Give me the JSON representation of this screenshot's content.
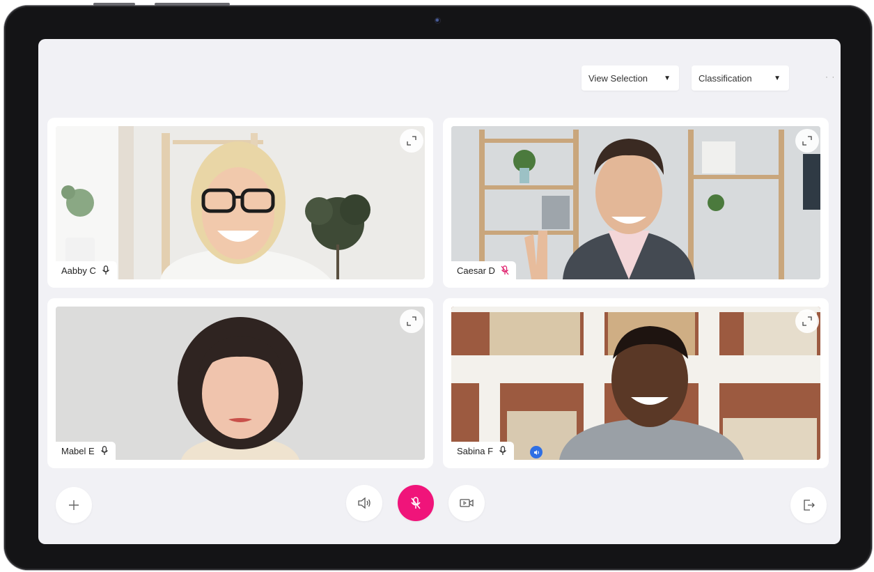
{
  "toolbar": {
    "view_selection": "View Selection",
    "classification": "Classification"
  },
  "participants": [
    {
      "name": "Aabby C",
      "mic": "on"
    },
    {
      "name": "Caesar D",
      "mic": "muted"
    },
    {
      "name": "Mabel E",
      "mic": "on"
    },
    {
      "name": "Sabina F",
      "mic": "on",
      "speaking": true
    }
  ],
  "colors": {
    "accent": "#f0147a",
    "muted_icon": "#e0246f",
    "speaking_badge": "#2f6fe4",
    "screen_bg": "#f1f1f5"
  },
  "icons": {
    "add": "plus-icon",
    "speaker": "speaker-icon",
    "mic": "mic-off-icon",
    "video": "video-camera-icon",
    "leave": "exit-icon",
    "expand": "expand-icon"
  }
}
